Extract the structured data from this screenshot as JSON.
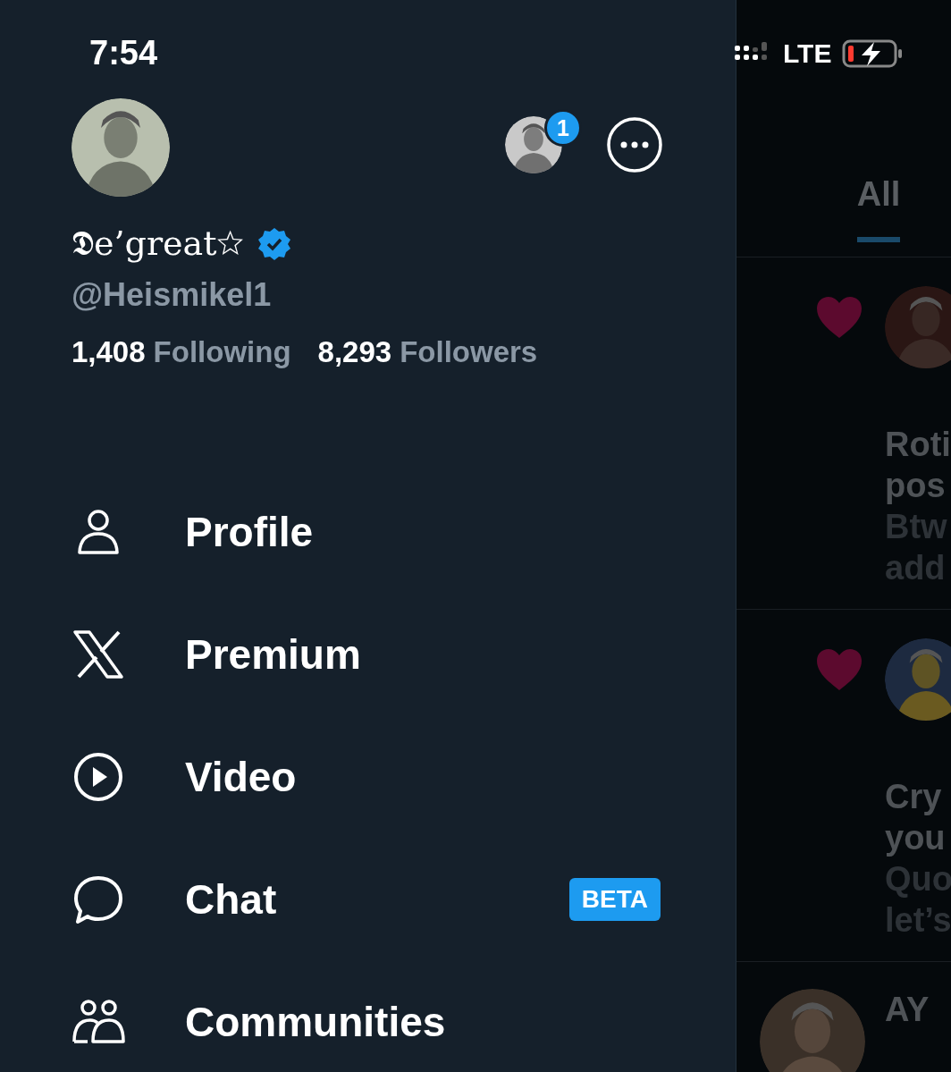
{
  "status_bar": {
    "time": "7:54",
    "network": "LTE"
  },
  "profile": {
    "name": "𝕯e’great☆",
    "verified": true,
    "handle": "@Heismikel1",
    "account_badge": "1",
    "following_count": "1,408",
    "following_label": "Following",
    "followers_count": "8,293",
    "followers_label": "Followers"
  },
  "menu": [
    {
      "kind": "profile",
      "label": "Profile"
    },
    {
      "kind": "premium",
      "label": "Premium"
    },
    {
      "kind": "video",
      "label": "Video"
    },
    {
      "kind": "chat",
      "label": "Chat",
      "badge": "BETA"
    },
    {
      "kind": "communities",
      "label": "Communities"
    }
  ],
  "background_feed": {
    "tabs": [
      {
        "label": "All",
        "selected": true
      }
    ],
    "posts": [
      {
        "kind": "like_notification",
        "title": [
          "Roti",
          "pos"
        ],
        "body": [
          "Btw",
          "add"
        ]
      },
      {
        "kind": "like_notification",
        "title": [
          "Cry",
          "you"
        ],
        "body": [
          "Quo",
          "let’s"
        ]
      },
      {
        "kind": "tweet",
        "title": [
          "AY"
        ]
      }
    ]
  }
}
